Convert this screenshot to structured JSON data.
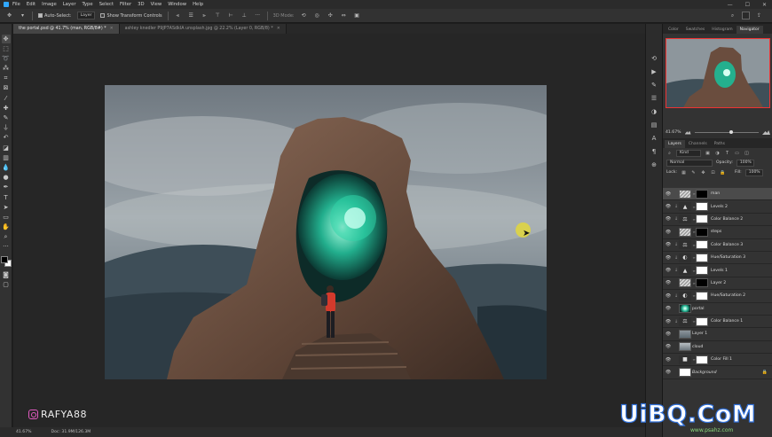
{
  "menubar": {
    "items": [
      "File",
      "Edit",
      "Image",
      "Layer",
      "Type",
      "Select",
      "Filter",
      "3D",
      "View",
      "Window",
      "Help"
    ],
    "window_controls": [
      "—",
      "☐",
      "✕"
    ]
  },
  "optionsbar": {
    "auto_select_label": "Auto-Select:",
    "auto_select_value": "Layer",
    "transform_label": "Show Transform Controls",
    "mode_label": "3D Mode:"
  },
  "tabs": [
    {
      "label": "the portal.psd @ 41.7% (man, RGB/8#) *",
      "active": true
    },
    {
      "label": "ashley knedler P9JP7ASdkIA unsplash.jpg @ 22.2% (Layer 0, RGB/8) *",
      "active": false
    }
  ],
  "status": {
    "zoom": "41.67%",
    "doc": "Doc: 31.9M/126.3M"
  },
  "watermark": "RAFYA88",
  "navigator": {
    "tabs": [
      "Color",
      "Swatches",
      "Histogram",
      "Navigator"
    ],
    "active_tab": "Navigator",
    "zoom": "41.67%"
  },
  "layers_panel": {
    "tabs": [
      "Layers",
      "Channels",
      "Paths"
    ],
    "active_tab": "Layers",
    "filter_kind": "Kind",
    "blend_mode": "Normal",
    "opacity_label": "Opacity:",
    "opacity_value": "100%",
    "lock_label": "Lock:",
    "fill_label": "Fill:",
    "fill_value": "100%",
    "layers": [
      {
        "name": "man",
        "selected": true,
        "clip": false,
        "kind": "photo",
        "mask": "black"
      },
      {
        "name": "Levels 2",
        "selected": false,
        "clip": true,
        "kind": "levels",
        "mask": "white"
      },
      {
        "name": "Color Balance 2",
        "selected": false,
        "clip": true,
        "kind": "balance",
        "mask": "white"
      },
      {
        "name": "steps",
        "selected": false,
        "clip": false,
        "kind": "photo",
        "mask": "black"
      },
      {
        "name": "Color Balance 3",
        "selected": false,
        "clip": true,
        "kind": "balance",
        "mask": "white"
      },
      {
        "name": "Hue/Saturation 3",
        "selected": false,
        "clip": true,
        "kind": "hue",
        "mask": "white"
      },
      {
        "name": "Levels 1",
        "selected": false,
        "clip": true,
        "kind": "levels",
        "mask": "white"
      },
      {
        "name": "Layer 2",
        "selected": false,
        "clip": false,
        "kind": "photo",
        "mask": "black"
      },
      {
        "name": "Hue/Saturation 2",
        "selected": false,
        "clip": true,
        "kind": "hue",
        "mask": "white"
      },
      {
        "name": "portal",
        "selected": false,
        "clip": false,
        "kind": "portal",
        "mask": "none"
      },
      {
        "name": "Color Balance 1",
        "selected": false,
        "clip": true,
        "kind": "balance",
        "mask": "white"
      },
      {
        "name": "Layer 1",
        "selected": false,
        "clip": false,
        "kind": "sky",
        "mask": "none"
      },
      {
        "name": "cloud",
        "selected": false,
        "clip": false,
        "kind": "cloud",
        "mask": "none"
      },
      {
        "name": "Color Fill 1",
        "selected": false,
        "clip": false,
        "kind": "fill",
        "mask": "white"
      },
      {
        "name": "Background",
        "selected": false,
        "clip": false,
        "kind": "white",
        "mask": "none",
        "locked": true
      }
    ]
  },
  "brand_overlay": {
    "text": "UiBQ.CoM",
    "sub": "www.psahz.com"
  }
}
